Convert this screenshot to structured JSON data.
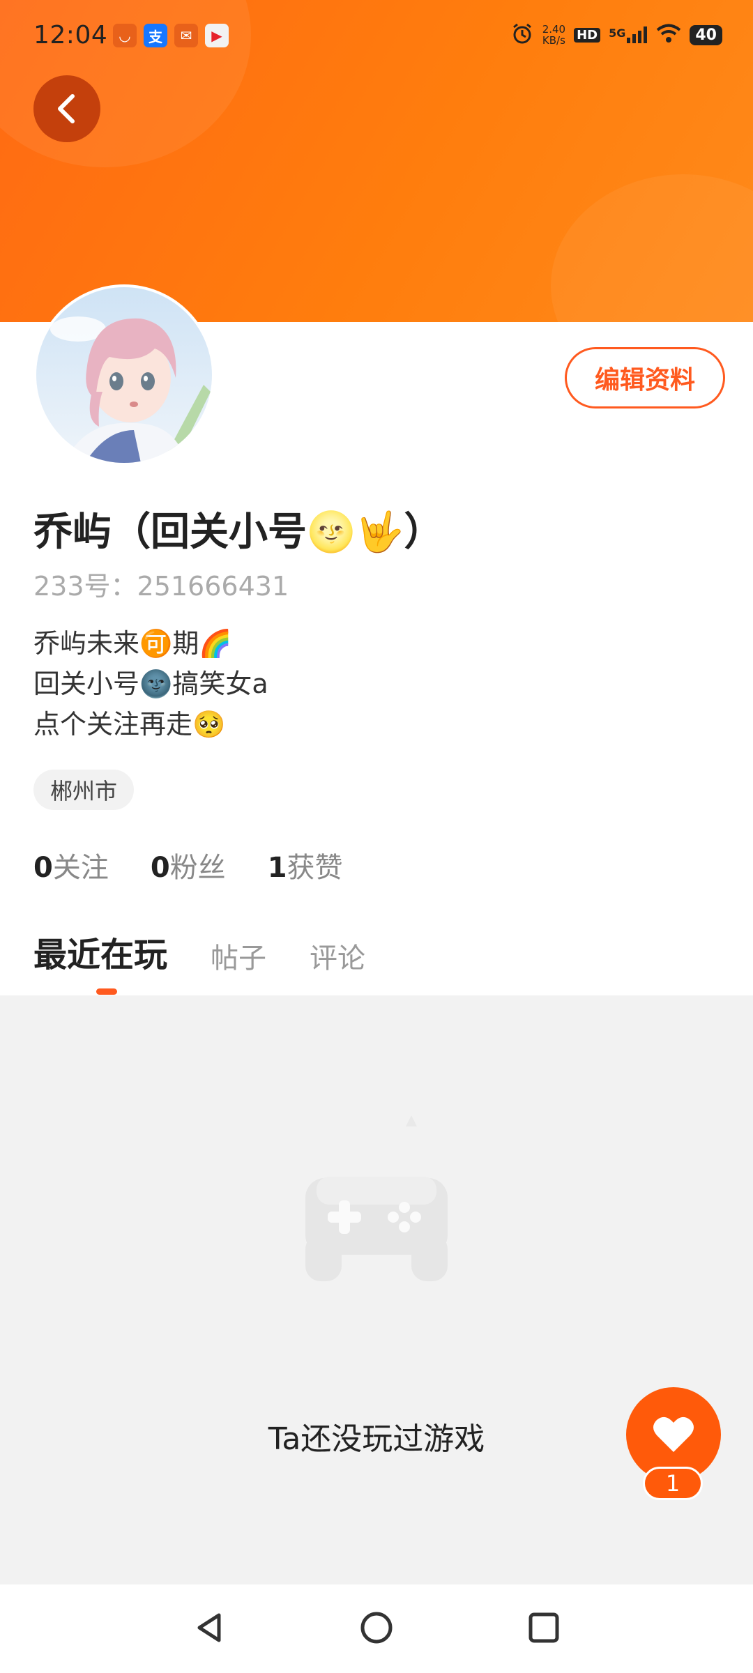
{
  "status_bar": {
    "time": "12:04",
    "net_speed_value": "2.40",
    "net_speed_unit": "KB/s",
    "hd": "HD",
    "network": "5G",
    "battery": "40",
    "app_icons": [
      "taobao-icon",
      "alipay-icon",
      "mail-icon",
      "video-icon"
    ],
    "app_glyphs": [
      "◡",
      "支",
      "✉",
      "▶"
    ]
  },
  "profile": {
    "name": "乔屿（回关小号🌝🤟）",
    "uid": "233号：251666431",
    "bio": [
      "乔屿未来🉑期🌈",
      "回关小号🌚搞笑女a",
      "点个关注再走🥺"
    ],
    "location": "郴州市",
    "edit_label": "编辑资料"
  },
  "stats": {
    "following_num": "0",
    "following_label": "关注",
    "fans_num": "0",
    "fans_label": "粉丝",
    "likes_num": "1",
    "likes_label": "获赞"
  },
  "tabs": [
    "最近在玩",
    "帖子",
    "评论"
  ],
  "empty_state": {
    "text": "Ta还没玩过游戏"
  },
  "like_fab": {
    "count": "1"
  },
  "colors": {
    "accent": "#ff5a1f",
    "header": "#ff7a10",
    "fab": "#ff5a0a"
  }
}
